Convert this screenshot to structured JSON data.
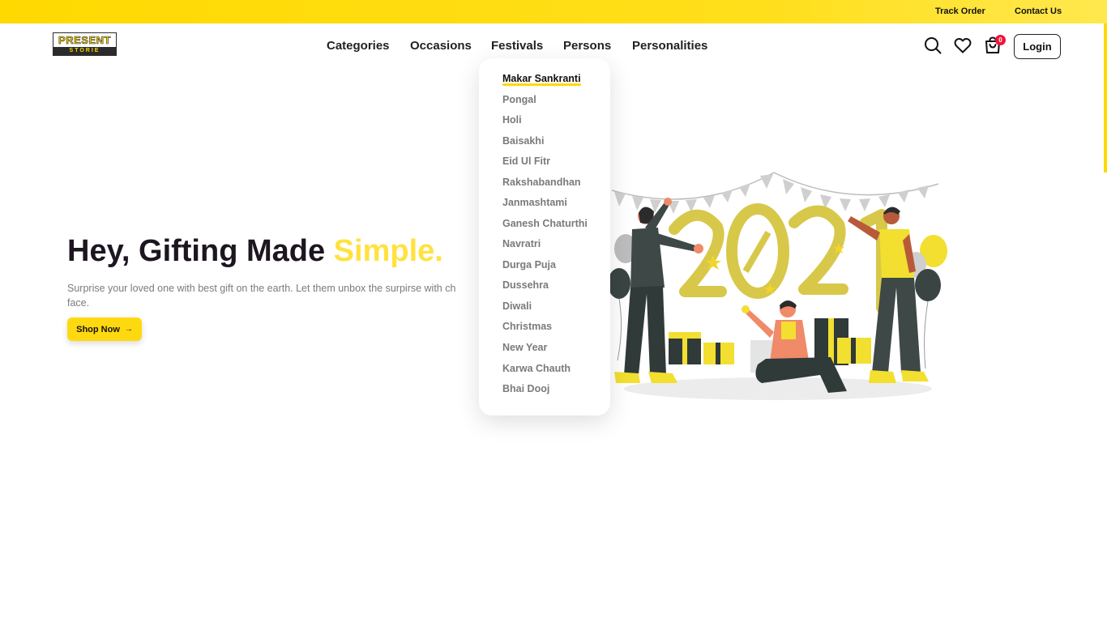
{
  "topbar": {
    "track_order": "Track Order",
    "contact_us": "Contact Us"
  },
  "logo": {
    "line1": "PRESENT",
    "line2": "STORIE"
  },
  "nav": {
    "items": [
      "Categories",
      "Occasions",
      "Festivals",
      "Persons",
      "Personalities"
    ]
  },
  "header_actions": {
    "cart_count": "0",
    "login_label": "Login",
    "icons": [
      "search-icon",
      "heart-icon",
      "shopping-bag-icon"
    ]
  },
  "hero": {
    "title_main": "Hey, Gifting Made ",
    "title_accent": "Simple.",
    "subtitle": "Surprise your loved one with best gift on the earth. Let them unbox the surpirse with ch",
    "subtitle_line2": "face.",
    "shop_button": "Shop Now",
    "shop_arrow": "→"
  },
  "festivals_dropdown": {
    "active": "Makar Sankranti",
    "items": [
      "Makar Sankranti",
      "Pongal",
      "Holi",
      "Baisakhi",
      "Eid Ul Fitr",
      "Rakshabandhan",
      "Janmashtami",
      "Ganesh Chaturthi",
      "Navratri",
      "Durga Puja",
      "Dussehra",
      "Diwali",
      "Christmas",
      "New Year",
      "Karwa Chauth",
      "Bhai Dooj"
    ]
  },
  "illustration": {
    "year_text": "2021"
  },
  "colors": {
    "brand_yellow": "#ffd900",
    "accent_title": "#ffe23f",
    "badge_red": "#f0133b",
    "dark": "#1d1520"
  }
}
